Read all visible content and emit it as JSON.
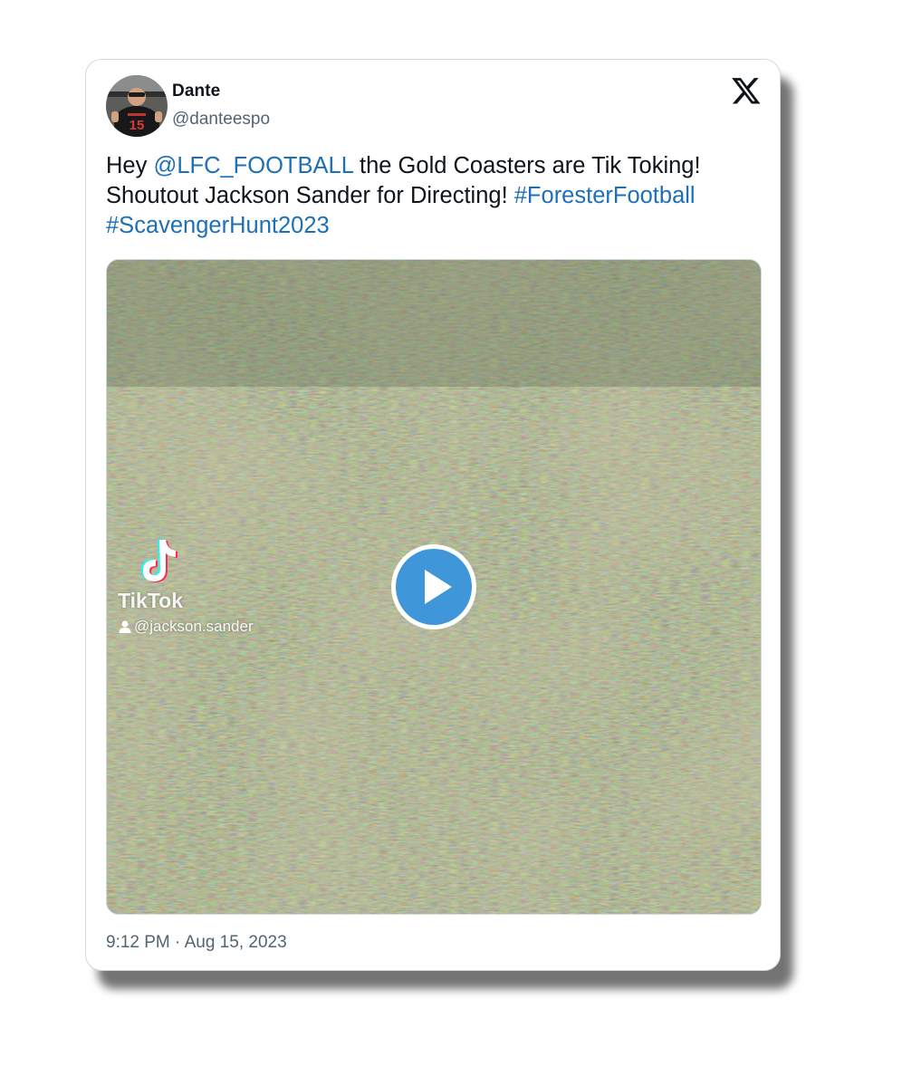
{
  "tweet": {
    "author": {
      "display_name": "Dante",
      "handle": "@danteespo",
      "avatar_jersey_number": "15"
    },
    "text": {
      "part1": "Hey ",
      "mention": "@LFC_FOOTBALL",
      "part2": " the Gold Coasters are Tik Toking! Shoutout Jackson Sander for Directing! ",
      "hashtag1": "#ForesterFootball",
      "hashtag2": "#ScavengerHunt2023"
    },
    "media": {
      "type": "video",
      "watermark_brand": "TikTok",
      "watermark_user": "@jackson.sander"
    },
    "timestamp": "9:12 PM · Aug 15, 2023"
  },
  "icons": [
    "x-logo-icon",
    "play-icon",
    "tiktok-note-icon",
    "person-icon"
  ],
  "colors": {
    "link": "#1d6fb8",
    "play_button": "#1d8ce0",
    "text": "#0f1419",
    "secondary_text": "#536471"
  }
}
